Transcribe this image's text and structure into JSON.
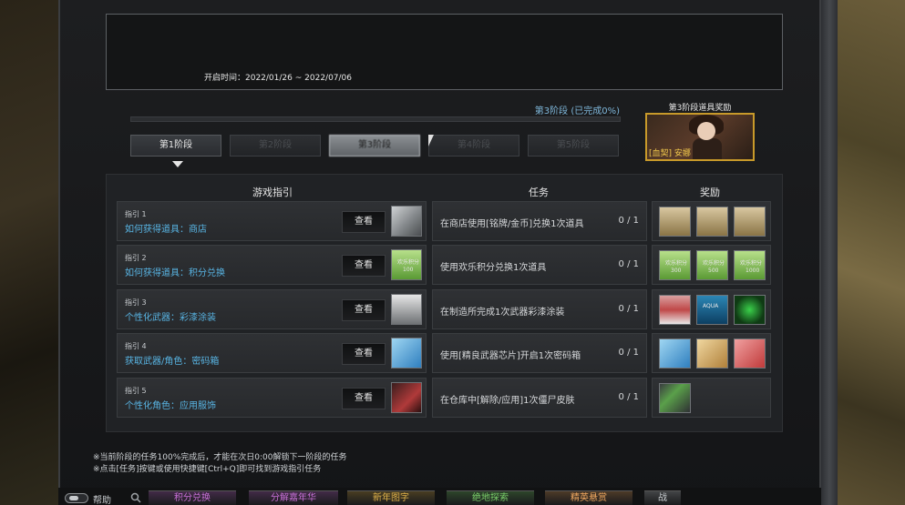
{
  "event": {
    "time_label": "开启时间：2022/01/26 ~ 2022/07/06"
  },
  "progress": {
    "label": "第3阶段 (已完成0%)",
    "completion_fraction": 0.0
  },
  "stages": [
    {
      "label": "第1阶段",
      "state": "active"
    },
    {
      "label": "第2阶段",
      "state": "locked"
    },
    {
      "label": "第3阶段",
      "state": "current"
    },
    {
      "label": "第4阶段",
      "state": "locked"
    },
    {
      "label": "第5阶段",
      "state": "locked"
    }
  ],
  "stage_reward": {
    "title": "第3阶段道具奖励",
    "item_label": "[血契] 安娜"
  },
  "headers": {
    "guide": "游戏指引",
    "task": "任务",
    "reward": "奖励"
  },
  "view_label": "查看",
  "rows": [
    {
      "guide_no": "指引 1",
      "guide_title": "如何获得道具：商店",
      "task": "在商店使用[铭牌/金币]兑换1次道具",
      "count": "0 / 1",
      "thumb_icon": "weapon-grey-icon",
      "rewards": [
        {
          "icon": "gold-card-icon",
          "text": "",
          "num": ""
        },
        {
          "icon": "gold-card-icon",
          "text": "",
          "num": ""
        },
        {
          "icon": "gold-card-icon",
          "text": "",
          "num": ""
        }
      ]
    },
    {
      "guide_no": "指引 2",
      "guide_title": "如何获得道具：积分兑换",
      "task": "使用欢乐积分兑换1次道具",
      "count": "0 / 1",
      "thumb_icon": "points-card-icon",
      "thumb_text": "欢乐积分",
      "thumb_num": "100",
      "rewards": [
        {
          "icon": "points-card-icon",
          "text": "欢乐积分",
          "num": "300"
        },
        {
          "icon": "points-card-icon",
          "text": "欢乐积分",
          "num": "500"
        },
        {
          "icon": "points-card-icon",
          "text": "欢乐积分",
          "num": "1000"
        }
      ]
    },
    {
      "guide_no": "指引 3",
      "guide_title": "个性化武器：彩漆涂装",
      "task": "在制造所完成1次武器彩漆涂装",
      "count": "0 / 1",
      "thumb_icon": "spray-paint-icon",
      "rewards": [
        {
          "icon": "red-paint-icon",
          "text": "",
          "num": ""
        },
        {
          "icon": "aqua-paint-icon",
          "text": "AQUA",
          "num": ""
        },
        {
          "icon": "green-paint-icon",
          "text": "",
          "num": ""
        }
      ]
    },
    {
      "guide_no": "指引 4",
      "guide_title": "获取武器/角色：密码箱",
      "task": "使用[精良武器芯片]开启1次密码箱",
      "count": "0 / 1",
      "thumb_icon": "blue-chip-icon",
      "rewards": [
        {
          "icon": "blue-chip-icon",
          "text": "",
          "num": ""
        },
        {
          "icon": "gold-chip-icon",
          "text": "",
          "num": ""
        },
        {
          "icon": "red-chip-icon",
          "text": "",
          "num": ""
        }
      ]
    },
    {
      "guide_no": "指引 5",
      "guide_title": "个性化角色：应用服饰",
      "task": "在仓库中[解除/应用]1次僵尸皮肤",
      "count": "0 / 1",
      "thumb_icon": "zombie-skin-icon",
      "rewards": [
        {
          "icon": "green-box-icon",
          "text": "",
          "num": ""
        }
      ]
    }
  ],
  "notes": [
    "※当前阶段的任务100%完成后，才能在次日0:00解锁下一阶段的任务",
    "※点击[任务]按键或使用快捷键[Ctrl+Q]即可找到游戏指引任务"
  ],
  "bottom": {
    "help_label": "帮助",
    "buttons": [
      {
        "label": "积分兑换",
        "color": "#c76fd6"
      },
      {
        "label": "分解嘉年华",
        "color": "#c76fd6"
      },
      {
        "label": "新年图字",
        "color": "#e0b24a"
      },
      {
        "label": "绝地探索",
        "color": "#7bd06b"
      },
      {
        "label": "精英悬赏",
        "color": "#f0a860"
      },
      {
        "label": "战",
        "color": "#c9cdd0"
      }
    ]
  },
  "colors": {
    "accent_blue": "#58b4e3",
    "reward_border": "#c89a2a"
  }
}
